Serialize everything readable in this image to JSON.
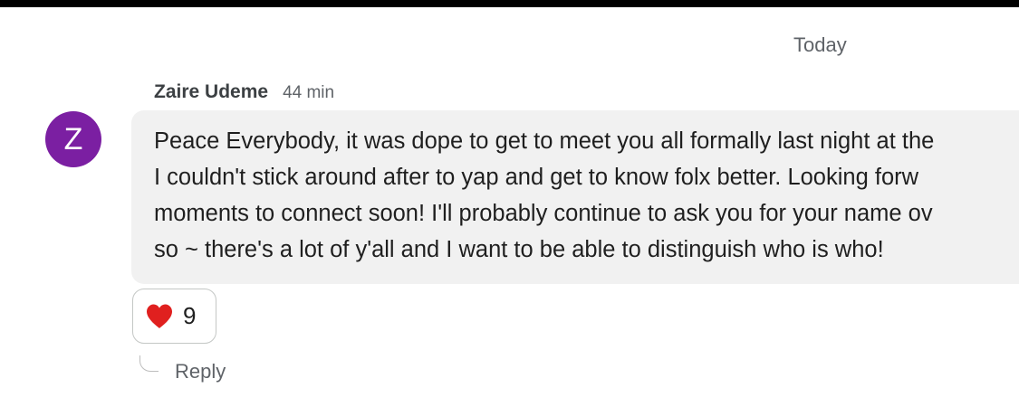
{
  "date_divider": "Today",
  "message": {
    "avatar_letter": "Z",
    "avatar_color": "#7b1fa2",
    "sender": "Zaire Udeme",
    "time": "44 min",
    "lines": [
      "Peace Everybody, it was dope to get to meet you all formally last night at the",
      "I couldn't stick around after to yap and get to know folx better. Looking forw",
      "moments to connect soon! I'll probably continue to ask you for your name ov",
      "so ~ there's a lot of y'all and I want to be able to distinguish who is who!"
    ],
    "reactions": [
      {
        "icon": "heart-icon",
        "count": "9",
        "color": "#e0201f"
      }
    ],
    "reply_label": "Reply"
  }
}
